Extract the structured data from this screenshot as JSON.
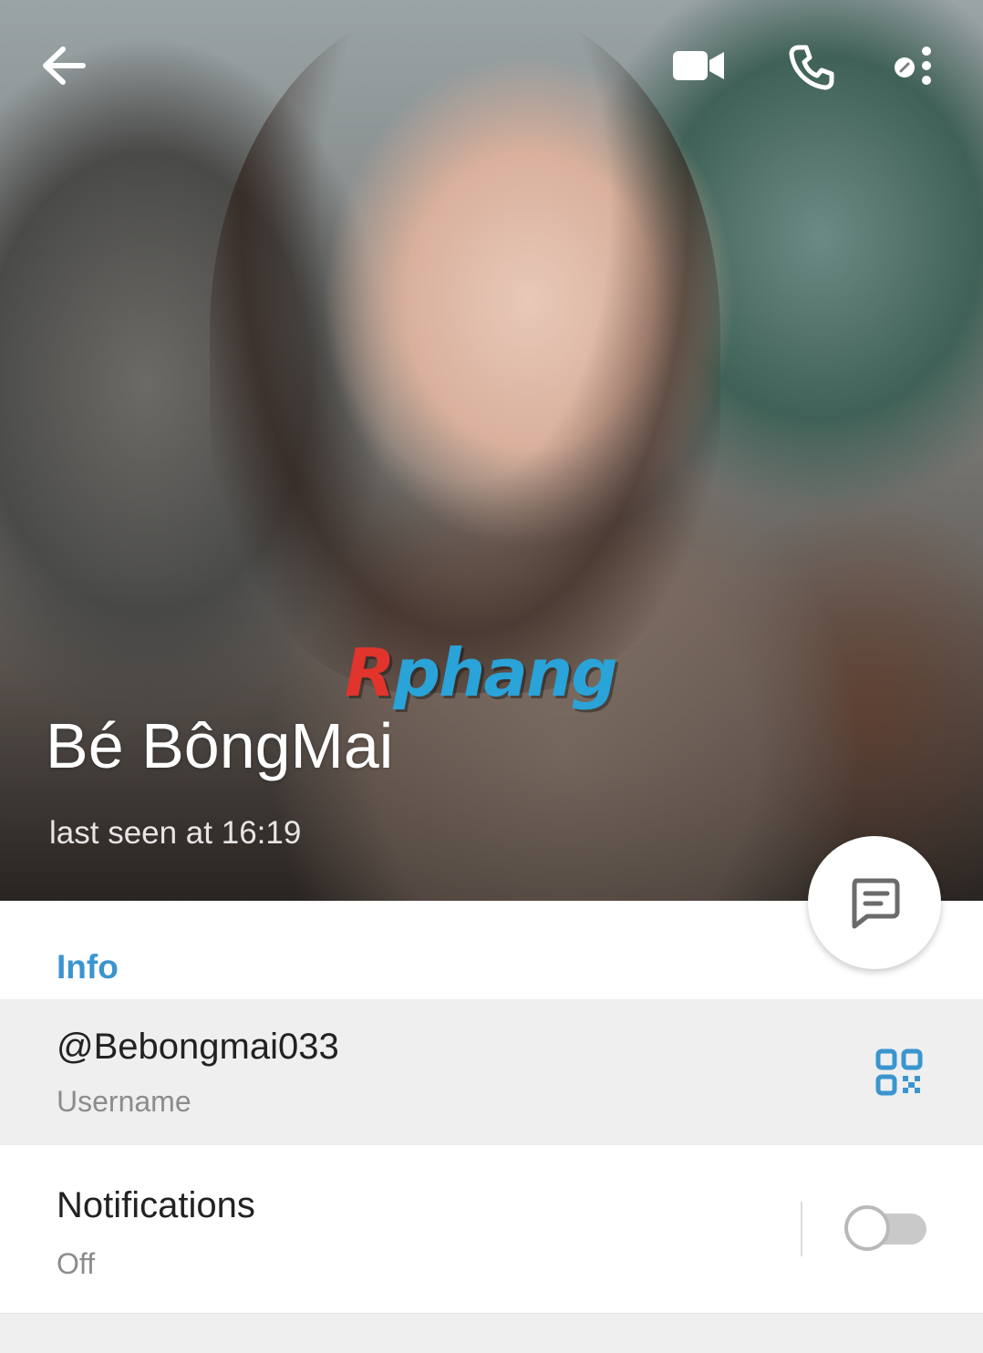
{
  "header": {
    "back_icon": "arrow-left-icon",
    "video_call_icon": "video-camera-icon",
    "voice_call_icon": "phone-icon",
    "more_icon": "more-vertical-icon"
  },
  "profile": {
    "name": "Bé BôngMai",
    "status": "last seen at 16:19",
    "watermark_part1": "R",
    "watermark_part2": "phang"
  },
  "fab": {
    "icon": "message-icon"
  },
  "info": {
    "section_title": "Info",
    "username_value": "@Bebongmai033",
    "username_label": "Username",
    "qr_icon": "qr-code-icon",
    "notifications_title": "Notifications",
    "notifications_value": "Off",
    "notifications_enabled": false
  },
  "colors": {
    "accent": "#3a95cf",
    "row_highlight": "#efefef",
    "secondary_text": "#8c8c8c"
  }
}
